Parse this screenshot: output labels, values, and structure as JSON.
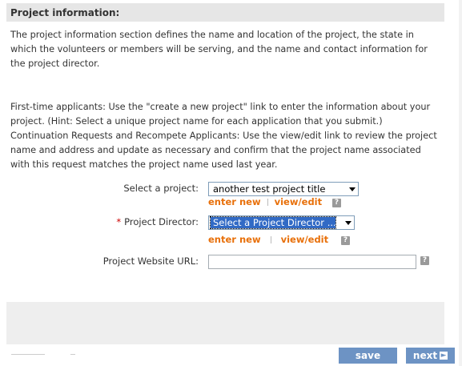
{
  "section": {
    "title": "Project information:"
  },
  "intro": {
    "paragraph1": "The project information section defines the name and location of the project, the state in which the volunteers or members will be serving, and the name and contact information for the project director.",
    "paragraph2": "First-time applicants: Use the \"create a new project\" link to enter the information about your project. (Hint: Select a unique project name for each application that you submit.) Continuation Requests and Recompete Applicants: Use the view/edit link to review the project name and address and update as necessary and confirm that the project name associated with this request matches the project name used last year."
  },
  "form": {
    "project": {
      "label": "Select a project:",
      "selected": "another test project title",
      "enter_new": "enter new",
      "view_edit": "view/edit"
    },
    "director": {
      "required_mark": "*",
      "label": "Project Director:",
      "selected": "Select a Project Director ...",
      "enter_new": "enter new",
      "view_edit": "view/edit"
    },
    "website": {
      "label": "Project Website URL:",
      "value": ""
    },
    "help_glyph": "?"
  },
  "footer": {
    "save_label": "save",
    "next_label": "next"
  },
  "colors": {
    "link_orange": "#e8700a",
    "button_blue": "#6d93c4",
    "header_gray": "#e6e6e6",
    "required_red": "#cc0000",
    "selection_blue": "#316ac5"
  },
  "icons": {
    "dropdown": "chevron-down-icon",
    "help": "help-icon",
    "next_arrow": "arrow-right-icon"
  }
}
